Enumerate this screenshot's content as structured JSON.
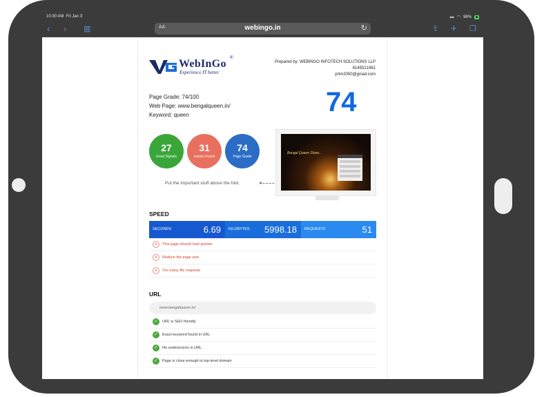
{
  "status_bar": {
    "time": "10:30 AM",
    "date": "Fri Jan 3",
    "battery": "98%"
  },
  "browser": {
    "text_size_label": "AA",
    "host": "webingo.in"
  },
  "report": {
    "logo": {
      "brand": "WebInGo",
      "registered": "®",
      "tagline": "Experience IT better"
    },
    "prepared_by": [
      "Prepared by: WEBINGO INFOTECH SOLUTIONS LLP",
      "8145521961",
      "prtm2050@gmail.com"
    ],
    "page_grade_line": "Page Grade: 74/100",
    "web_page_line": "Web Page: www.bengalqueen.in/",
    "keyword_line": "Keyword: queen",
    "big_score": "74",
    "circles": [
      {
        "value": "27",
        "label": "Good Signals"
      },
      {
        "value": "31",
        "label": "Issues Found"
      },
      {
        "value": "74",
        "label": "Page Grade"
      }
    ],
    "fold_tip": "Put the important stuff above the fold.",
    "site_preview_title": "Bengal Queen Show...",
    "speed": {
      "title": "SPEED",
      "seconds_label": "SECONDS",
      "seconds": "6.69",
      "kb_label": "KILOBYTES",
      "kilobytes": "5998.18",
      "req_label": "REQUESTS",
      "requests": "51",
      "issues": [
        "This page should load quicker",
        "Reduce the page size",
        "Too many file requests"
      ]
    },
    "url": {
      "title": "URL",
      "value": "www.bengalqueen.in/",
      "checks": [
        "URL is SEO friendly",
        "Exact keyword found in URL",
        "No underscores in URL",
        "Page is close enough to top-level domain"
      ]
    }
  },
  "colors": {
    "accent": "#1368e0",
    "good": "#3aa63a",
    "bad": "#e8705f",
    "grade": "#2c6cc5"
  }
}
